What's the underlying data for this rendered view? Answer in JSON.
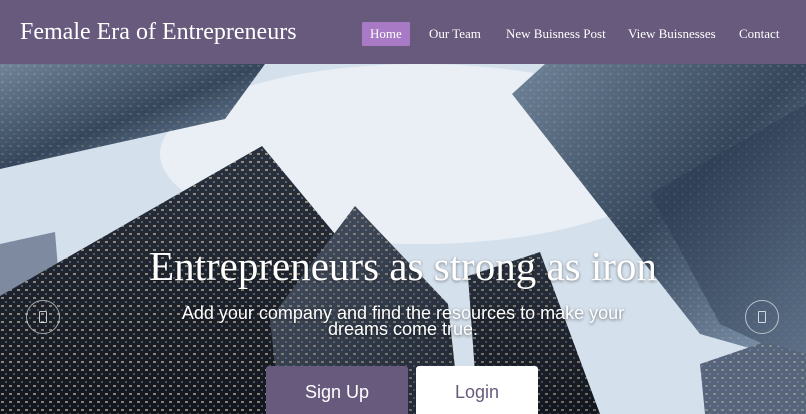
{
  "brand": {
    "name": "Female Era of Entrepreneurs"
  },
  "nav": {
    "items": [
      {
        "label": "Home",
        "active": true
      },
      {
        "label": "Our Team",
        "active": false
      },
      {
        "label": "New Buisness Post",
        "active": false
      },
      {
        "label": "View Buisnesses",
        "active": false
      },
      {
        "label": "Contact",
        "active": false
      }
    ]
  },
  "hero": {
    "title": "Entrepreneurs as strong as iron",
    "subtitle": "Add your company and find the resources to make your dreams come true.",
    "background": "city-skyscrapers-photo",
    "signup_label": "Sign Up",
    "login_label": "Login",
    "prev_icon": "carousel-prev-icon",
    "next_icon": "carousel-next-icon"
  },
  "colors": {
    "brand_purple": "#675a7c",
    "active_nav": "#a879c5",
    "text_light": "#ffffff"
  }
}
